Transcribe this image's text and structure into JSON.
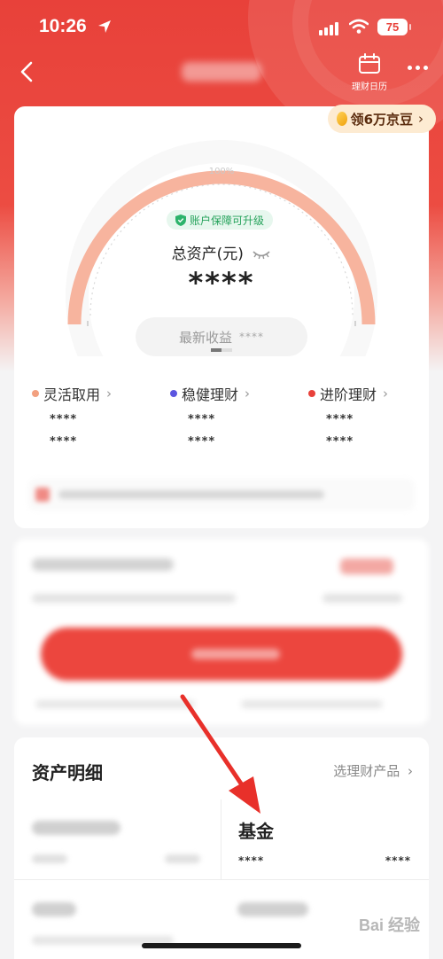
{
  "status_bar": {
    "time": "10:26",
    "battery": "75"
  },
  "nav": {
    "calendar_label": "理财日历"
  },
  "promo": {
    "bean_label": "领6万京豆"
  },
  "gauge": {
    "percent_label": "100%",
    "percent": 100,
    "colors": {
      "arc": "#f7b49e",
      "accent": "#ec463e"
    }
  },
  "asset": {
    "badge": "账户保障可升级",
    "total_label": "总资产(元)",
    "total_value": "****",
    "latest_label": "最新收益",
    "latest_value": "****"
  },
  "categories": [
    {
      "title": "灵活取用",
      "color": "#f2a07f",
      "value1": "****",
      "value2": "****"
    },
    {
      "title": "稳健理财",
      "color": "#5b55e0",
      "value1": "****",
      "value2": "****"
    },
    {
      "title": "进阶理财",
      "color": "#e8413a",
      "value1": "****",
      "value2": "****"
    }
  ],
  "details": {
    "title": "资产明细",
    "link": "选理财产品",
    "fund_title": "基金",
    "fund_value1": "****",
    "fund_value2": "****"
  },
  "watermark": "Bai 经验"
}
